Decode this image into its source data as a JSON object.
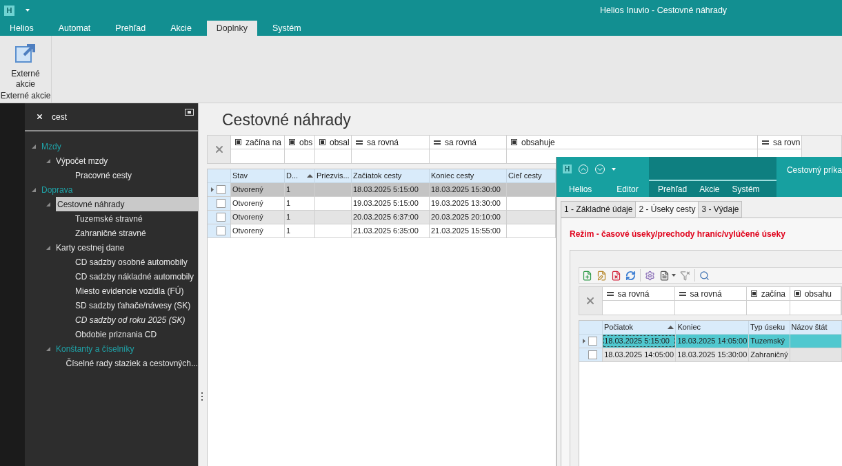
{
  "app": {
    "logo": "H",
    "title": "Helios Inuvio - Cestovné náhrady"
  },
  "ribbon_tabs": [
    {
      "label": "Helios",
      "selected": false
    },
    {
      "label": "Automat",
      "selected": false
    },
    {
      "label": "Prehľad",
      "selected": false
    },
    {
      "label": "Akcie",
      "selected": false
    },
    {
      "label": "Doplnky",
      "selected": true
    },
    {
      "label": "Systém",
      "selected": false
    }
  ],
  "ribbon": {
    "button": {
      "label": "Externé akcie"
    },
    "group_label": "Externé akcie"
  },
  "sidebar": {
    "search": {
      "value": "cest"
    },
    "tree": [
      {
        "label": "Mzdy",
        "kind": "module",
        "expanded": true,
        "selected": false,
        "children": [
          {
            "label": "Výpočet mzdy",
            "kind": "folder",
            "expanded": true,
            "selected": false,
            "children": [
              {
                "label": "Pracovné cesty",
                "kind": "leaf",
                "selected": false,
                "italic": false
              }
            ]
          }
        ]
      },
      {
        "label": "Doprava",
        "kind": "module",
        "expanded": true,
        "selected": false,
        "children": [
          {
            "label": "Cestovné náhrady",
            "kind": "folder",
            "expanded": true,
            "selected": true,
            "children": [
              {
                "label": "Tuzemské stravné",
                "kind": "leaf",
                "selected": false,
                "italic": false
              },
              {
                "label": "Zahraničné stravné",
                "kind": "leaf",
                "selected": false,
                "italic": false
              }
            ]
          },
          {
            "label": "Karty cestnej dane",
            "kind": "folder",
            "expanded": true,
            "selected": false,
            "children": [
              {
                "label": "CD sadzby osobné automobily",
                "kind": "leaf",
                "selected": false,
                "italic": false
              },
              {
                "label": "CD sadzby nákladné automobily",
                "kind": "leaf",
                "selected": false,
                "italic": false
              },
              {
                "label": "Miesto evidencie vozidla (FÚ)",
                "kind": "leaf",
                "selected": false,
                "italic": false
              },
              {
                "label": "SD sadzby ťahače/návesy (SK)",
                "kind": "leaf",
                "selected": false,
                "italic": false
              },
              {
                "label": "CD sadzby od roku 2025 (SK)",
                "kind": "leaf",
                "selected": false,
                "italic": true
              },
              {
                "label": "Obdobie priznania CD",
                "kind": "leaf",
                "selected": false,
                "italic": false
              }
            ]
          },
          {
            "label": "Konštanty a číselníky",
            "kind": "module",
            "expanded": true,
            "selected": false,
            "children": [
              {
                "label": "Číselné rady staziek a cestovných...",
                "kind": "leaf",
                "selected": false,
                "italic": false
              }
            ]
          }
        ]
      }
    ]
  },
  "main": {
    "title": "Cestovné náhrady",
    "filters": [
      {
        "kind": "text",
        "label": "začína na"
      },
      {
        "kind": "text",
        "label": "obs"
      },
      {
        "kind": "text",
        "label": "obsal"
      },
      {
        "kind": "equals",
        "label": "sa rovná"
      },
      {
        "kind": "equals",
        "label": "sa rovná"
      },
      {
        "kind": "text",
        "label": "obsahuje"
      },
      {
        "kind": "equals",
        "label": "sa rovn"
      }
    ],
    "columns": [
      {
        "label": "Stav",
        "sorted": false
      },
      {
        "label": "D...",
        "sorted": true
      },
      {
        "label": "Priezvis...",
        "sorted": false
      },
      {
        "label": "Začiatok cesty",
        "sorted": false
      },
      {
        "label": "Koniec cesty",
        "sorted": false
      },
      {
        "label": "Cieľ cesty",
        "sorted": false
      }
    ],
    "rows": [
      {
        "selected": true,
        "checked": false,
        "cells": [
          "Otvorený",
          "1",
          null,
          "18.03.2025 5:15:00",
          "18.03.2025 15:30:00",
          null
        ]
      },
      {
        "selected": false,
        "checked": false,
        "cells": [
          "Otvorený",
          "1",
          null,
          "19.03.2025 5:15:00",
          "19.03.2025 13:30:00",
          null
        ]
      },
      {
        "selected": false,
        "checked": false,
        "cells": [
          "Otvorený",
          "1",
          null,
          "20.03.2025 6:37:00",
          "20.03.2025 20:10:00",
          null
        ]
      },
      {
        "selected": false,
        "checked": false,
        "cells": [
          "Otvorený",
          "1",
          null,
          "21.03.2025 6:35:00",
          "21.03.2025 15:55:00",
          null
        ]
      }
    ]
  },
  "detail": {
    "logo": "H",
    "title": "Cestovný príka",
    "ribbon_tabs": [
      {
        "label": "Helios",
        "contextual": false
      },
      {
        "label": "Editor",
        "contextual": false
      },
      {
        "label": "Prehľad",
        "contextual": true
      },
      {
        "label": "Akcie",
        "contextual": true
      },
      {
        "label": "Systém",
        "contextual": true
      }
    ],
    "page_tabs": [
      {
        "label": "1 - Základné údaje",
        "selected": false
      },
      {
        "label": "2 - Úseky cesty",
        "selected": true
      },
      {
        "label": "3 - Výdaje",
        "selected": false
      }
    ],
    "mode_text": "Režim - časové úseky/prechody hraníc/vylúčené úseky",
    "filters": [
      {
        "kind": "equals",
        "label": "sa rovná"
      },
      {
        "kind": "equals",
        "label": "sa rovná"
      },
      {
        "kind": "text",
        "label": "začína"
      },
      {
        "kind": "text",
        "label": "obsahu"
      }
    ],
    "columns": [
      {
        "label": "Počiatok",
        "sorted": true
      },
      {
        "label": "Koniec",
        "sorted": false
      },
      {
        "label": "Typ úseku",
        "sorted": false
      },
      {
        "label": "Názov štát",
        "sorted": false
      }
    ],
    "rows": [
      {
        "selected": true,
        "checked": false,
        "cells": [
          "18.03.2025 5:15:00",
          "18.03.2025 14:05:00",
          "Tuzemský",
          null
        ]
      },
      {
        "selected": false,
        "checked": false,
        "cells": [
          "18.03.2025 14:05:00",
          "18.03.2025 15:30:00",
          "Zahraničný",
          null
        ]
      }
    ]
  }
}
